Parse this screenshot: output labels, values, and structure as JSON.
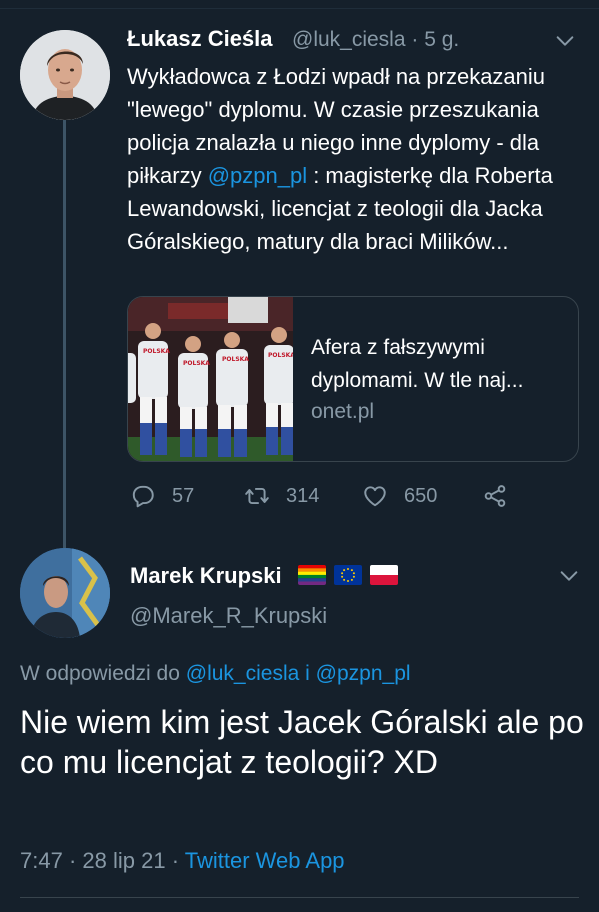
{
  "tweet1": {
    "author_name": "Łukasz Cieśla",
    "handle": "@luk_ciesla",
    "separator": "·",
    "age": "5 g.",
    "text_part1": "Wykładowca z Łodzi wpadł na przekazaniu \"lewego\" dyplomu. W czasie przeszukania policja znalazła u niego inne dyplomy - dla piłkarzy ",
    "mention": "@pzpn_pl",
    "text_part2": " : magisterkę dla Roberta Lewandowski, licencjat z teologii dla  Jacka Góralskiego, matury dla braci Milików...",
    "card": {
      "title": "Afera z fałszywymi dyplomami. W tle naj...",
      "domain": "onet.pl",
      "jersey_text": "POLSKA"
    },
    "stats": {
      "replies": "57",
      "retweets": "314",
      "likes": "650"
    }
  },
  "tweet2": {
    "author_name": "Marek Krupski",
    "flags": [
      "rainbow-flag",
      "eu-flag",
      "poland-flag"
    ],
    "handle": "@Marek_R_Krupski",
    "reply_prefix": "W odpowiedzi do",
    "reply_user1": "@luk_ciesla",
    "reply_and": "i",
    "reply_user2": "@pzpn_pl",
    "text": "Nie wiem kim jest Jacek Góralski ale po co mu licencjat z teologii? XD",
    "time": "7:47",
    "date_sep": "·",
    "date": "28 lip 21",
    "source_sep": "·",
    "source": "Twitter Web App"
  },
  "colors": {
    "background": "#15202b",
    "text": "#ffffff",
    "secondary": "#8899a6",
    "accent": "#1b95e0",
    "border": "#38444d"
  },
  "icons": [
    "chevron-down-icon",
    "reply-icon",
    "retweet-icon",
    "like-icon",
    "share-icon"
  ]
}
